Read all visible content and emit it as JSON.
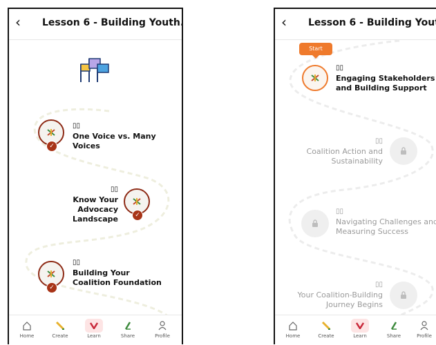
{
  "header": {
    "back_glyph": "‹",
    "title": "Lesson 6 - Building Youth..."
  },
  "phone1": {
    "lessons": [
      {
        "title": "One Voice vs. Many Voices",
        "status": "completed"
      },
      {
        "title": "Know Your Advocacy Landscape",
        "status": "completed"
      },
      {
        "title": "Building Your Coalition Foundation",
        "status": "completed"
      }
    ]
  },
  "phone2": {
    "start_label": "Start",
    "lessons": [
      {
        "title": "Engaging Stakeholders and Building Support",
        "status": "current"
      },
      {
        "title": "Coalition Action and Sustainability",
        "status": "locked"
      },
      {
        "title": "Navigating Challenges and Measuring Success",
        "status": "locked"
      },
      {
        "title": "Your Coalition-Building Journey Begins",
        "status": "locked"
      }
    ]
  },
  "tabbar": {
    "items": [
      {
        "label": "Home",
        "icon": "home-icon"
      },
      {
        "label": "Create",
        "icon": "pencil-icon"
      },
      {
        "label": "Learn",
        "icon": "learn-icon",
        "active": true
      },
      {
        "label": "Share",
        "icon": "share-icon"
      },
      {
        "label": "Profile",
        "icon": "profile-icon"
      }
    ]
  },
  "colors": {
    "completed": "#8e2b16",
    "current": "#ef7a2c",
    "locked": "#efefef",
    "path": "#eeeede"
  }
}
